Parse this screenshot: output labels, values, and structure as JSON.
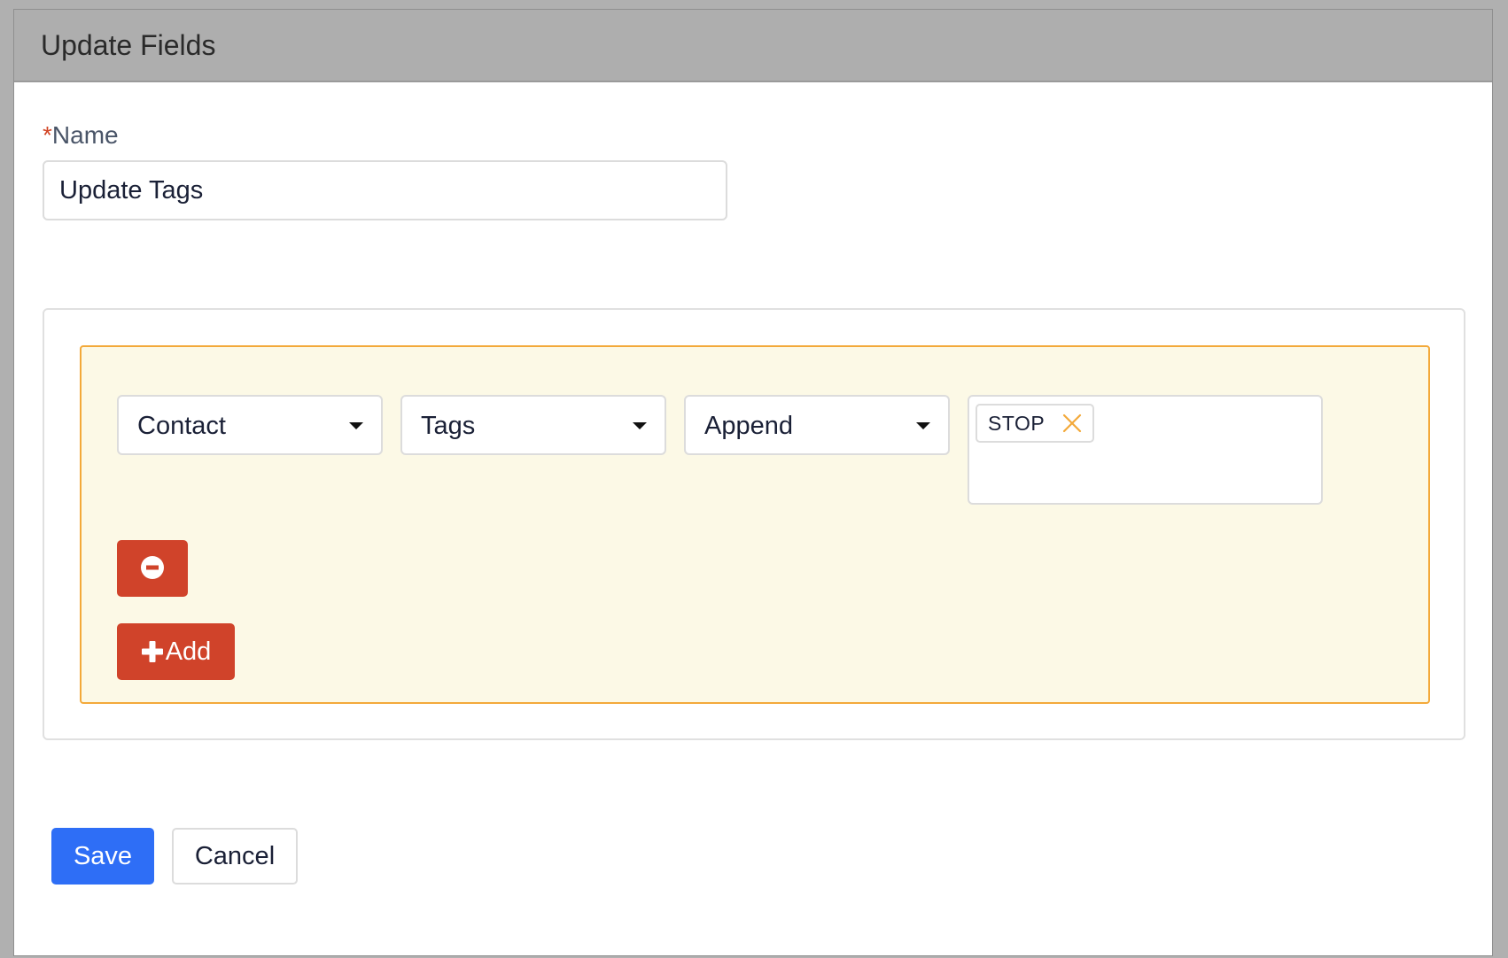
{
  "dialog": {
    "title": "Update Fields"
  },
  "name_field": {
    "required_mark": "*",
    "label": "Name",
    "value": "Update Tags"
  },
  "rule": {
    "object_select": "Contact",
    "field_select": "Tags",
    "operation_select": "Append",
    "tags": [
      {
        "label": "STOP",
        "remove_icon": "close-icon"
      }
    ],
    "remove_button_icon": "minus-circle-icon",
    "add_button_icon": "plus-icon",
    "add_button_label": "Add"
  },
  "footer": {
    "save_label": "Save",
    "cancel_label": "Cancel"
  },
  "colors": {
    "header_bg": "#aeaeae",
    "rule_panel_bg": "#fcf9e6",
    "rule_panel_border": "#f3a93a",
    "danger_button": "#d0432a",
    "primary_button": "#2e6ef6",
    "tag_remove_icon": "#f3a93a",
    "required_mark": "#d14424"
  }
}
